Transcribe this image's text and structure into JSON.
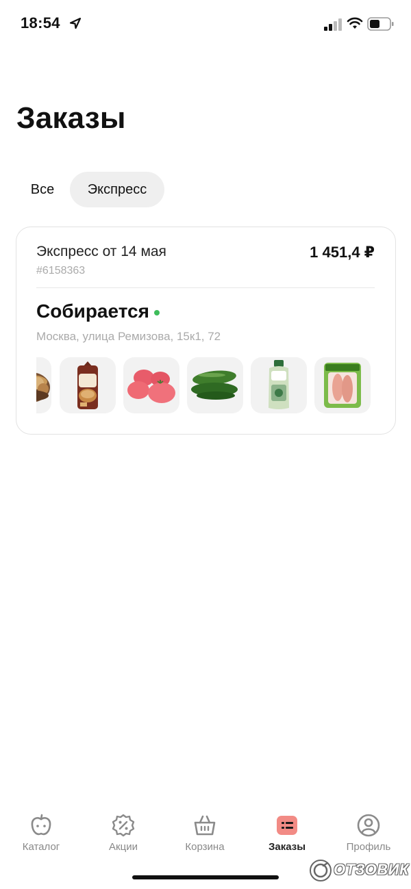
{
  "status_bar": {
    "time": "18:54"
  },
  "page": {
    "title": "Заказы"
  },
  "tabs": [
    {
      "label": "Все",
      "active": false
    },
    {
      "label": "Экспресс",
      "active": true
    }
  ],
  "order": {
    "title": "Экспресс от 14 мая",
    "price": "1 451,4 ₽",
    "number": "#6158363",
    "status": "Собирается",
    "status_color": "#3ebd5b",
    "address": "Москва, улица Ремизова, 15к1, 72",
    "products": [
      {
        "icon": "potato-bowl-icon"
      },
      {
        "icon": "bread-pack-icon"
      },
      {
        "icon": "tomatoes-icon"
      },
      {
        "icon": "cucumbers-icon"
      },
      {
        "icon": "detergent-bottle-icon"
      },
      {
        "icon": "meat-pack-icon"
      }
    ]
  },
  "bottom_nav": [
    {
      "label": "Каталог",
      "icon": "apple-icon",
      "active": false
    },
    {
      "label": "Акции",
      "icon": "discount-icon",
      "active": false
    },
    {
      "label": "Корзина",
      "icon": "basket-icon",
      "active": false
    },
    {
      "label": "Заказы",
      "icon": "orders-icon",
      "active": true
    },
    {
      "label": "Профиль",
      "icon": "profile-icon",
      "active": false
    }
  ],
  "watermark": {
    "text": "ОТЗОВИК"
  },
  "colors": {
    "accent": "#f28b85",
    "status_green": "#3ebd5b"
  }
}
